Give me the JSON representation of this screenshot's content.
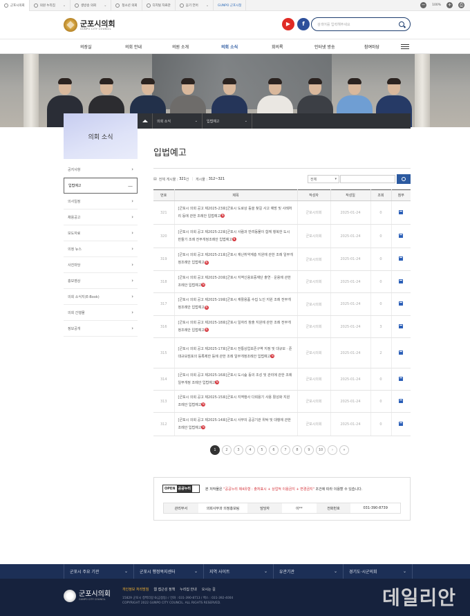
{
  "topbar": {
    "items": [
      {
        "label": "군포시의회",
        "active": true
      },
      {
        "label": "의원 누리집"
      },
      {
        "label": "생방송 의회"
      },
      {
        "label": "청소년 의회"
      },
      {
        "label": "디지털 자료관"
      },
      {
        "label": "듣기 언어"
      },
      {
        "label": "GUNPO 군포시청"
      }
    ],
    "zoom": "100%"
  },
  "header": {
    "logo_title": "군포시의회",
    "logo_sub": "GUNPO CITY COUNCIL",
    "search_placeholder": "검색어를 입력해주세요"
  },
  "gnb": {
    "items": [
      "의장실",
      "의회 안내",
      "의원 소개",
      "의회 소식",
      "회의록",
      "인터넷 방송",
      "참여마당"
    ],
    "active_index": 3
  },
  "breadcrumb": {
    "items": [
      "의회 소식",
      "입법예고"
    ]
  },
  "sidebar": {
    "title": "의회 소식",
    "items": [
      {
        "label": "공지사항"
      },
      {
        "label": "입법예고",
        "active": true
      },
      {
        "label": "의사일정"
      },
      {
        "label": "채용공고"
      },
      {
        "label": "보도자료"
      },
      {
        "label": "의정 뉴스"
      },
      {
        "label": "사진마당"
      },
      {
        "label": "홍보영상"
      },
      {
        "label": "의회 소식지(E-Book)"
      },
      {
        "label": "의회 간행물"
      },
      {
        "label": "정보공개"
      }
    ]
  },
  "main": {
    "title": "입법예고",
    "total_label": "전체 게시물 :",
    "total_value": "321",
    "total_unit": "건",
    "page_label": "게시물 :",
    "page_value": "312~321",
    "filter_select": "전체",
    "columns": [
      "번호",
      "제목",
      "작성자",
      "작성일",
      "조회",
      "첨부"
    ],
    "rows": [
      {
        "no": "321",
        "title": "[군포시 의회 공고 제2025-23호]군포시 도로상 등을 찾길 사고 예방 및 사례처리 등에 관한 조례안 입법예고",
        "author": "군포시의회",
        "date": "2025-01-24",
        "views": "0"
      },
      {
        "no": "320",
        "title": "[군포시 의회 공고 제2025-22호]군포시 사람과 반려동물이 함께 행복한 도시 만들기 조례 전부개정조례안 입법예고",
        "author": "군포시의회",
        "date": "2025-01-24",
        "views": "0"
      },
      {
        "no": "319",
        "title": "[군포시 의회 공고 제2025-21호]군포시 재난취약계층 지원에 관한 조례 일부개정조례안 입법예고",
        "author": "군포시의회",
        "date": "2025-01-24",
        "views": "0"
      },
      {
        "no": "318",
        "title": "[군포시 의회 공고 제2025-20호]군포시 지역신용보증재단 출연 · 운용에 관한 조례안 입법예고",
        "author": "군포시의회",
        "date": "2025-01-24",
        "views": "0"
      },
      {
        "no": "317",
        "title": "[군포시 의회 공고 제2025-19호]군포시 재활용품 수집 노인 지원 조례 전부개정조례안 입법예고",
        "author": "군포시의회",
        "date": "2025-01-24",
        "views": "0"
      },
      {
        "no": "316",
        "title": "[군포시 의회 공고 제2025-18호]군포시 일자리 창출 지원에 관한 조례 전부개정조례안 입법예고",
        "author": "군포시의회",
        "date": "2025-01-24",
        "views": "3"
      },
      {
        "no": "315",
        "title": "[군포시 의회 공고 제2025-17호]군포시 전통상업보존구역 지정 및 대규모 · 준대규모점포의 등록제한 등에 관한 조례 일부개정조례안 입법예고",
        "author": "군포시의회",
        "date": "2025-01-24",
        "views": "2"
      },
      {
        "no": "314",
        "title": "[군포시 의회 공고 제2025-16호]군포시 도시숲 등의 조성 및 관리에 관한 조례 일부개정 조례안 입법예고",
        "author": "군포시의회",
        "date": "2025-01-24",
        "views": "0"
      },
      {
        "no": "313",
        "title": "[군포시 의회 공고 제2025-15호]군포시 지역행사 다회용기 사용 활성화 지원 조례안 입법예고",
        "author": "군포시의회",
        "date": "2025-01-24",
        "views": "0"
      },
      {
        "no": "312",
        "title": "[군포시 의회 공고 제2025-14호]군포시 사무의 공공기관 위탁 및 대행에 관한 조례안 입법예고",
        "author": "군포시의회",
        "date": "2025-01-24",
        "views": "0"
      }
    ],
    "new_badge": "N"
  },
  "pager": {
    "pages": [
      "1",
      "2",
      "3",
      "4",
      "5",
      "6",
      "7",
      "8",
      "9",
      "10"
    ],
    "current": "1",
    "next": "›",
    "last": "»"
  },
  "license": {
    "kogl_a": "OPEN",
    "kogl_b": "공공누리",
    "text_pre": "본 저작물은",
    "text_red": "\"공공누리 제4유형 : 출처표시 + 상업적 이용금지 + 변경금지\"",
    "text_post": "조건에 따라 이용할 수 있습니다.",
    "dept_label": "관리부서",
    "dept_value": "의회사무과 의정홍보팀",
    "manager_label": "담당자",
    "manager_value": "이**",
    "phone_label": "전화번호",
    "phone_value": "031-390-8739"
  },
  "footer_links": [
    "군포시 주요 기관",
    "군포시 행정복지센터",
    "지역 사이트",
    "유관기관",
    "경기도·시군의회"
  ],
  "footer": {
    "logo_title": "군포시의회",
    "logo_sub": "GUNPO CITY COUNCIL",
    "menu": [
      "개인정보 처리방침",
      "웹 접근성 정책",
      "누리집 안내",
      "오시는 길"
    ],
    "addr1": "15829 군포시 청백리길 6(금정동) / 전화 : 031-390-8713 / 팩스 : 031-392-4004",
    "addr2": "COPYRIGHT 2022 GUNPO CITY COUNCIL. ALL RIGHTS RESERVED.",
    "watermark": "데일리안"
  },
  "colors": {
    "accent": "#2c5aa0",
    "footer_bg": "#16223d",
    "footer_links_bg": "#1c2f56",
    "new_badge": "#d5343b"
  }
}
